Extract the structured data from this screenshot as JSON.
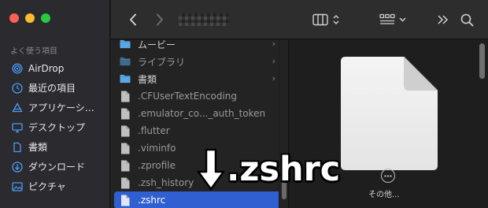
{
  "sidebar": {
    "section_title": "よく使う項目",
    "items": [
      {
        "label": "AirDrop",
        "icon": "airdrop-icon"
      },
      {
        "label": "最近の項目",
        "icon": "clock-icon"
      },
      {
        "label": "アプリケーシ…",
        "icon": "applications-icon"
      },
      {
        "label": "デスクトップ",
        "icon": "desktop-icon"
      },
      {
        "label": "書類",
        "icon": "document-icon"
      },
      {
        "label": "ダウンロード",
        "icon": "download-icon"
      },
      {
        "label": "ピクチャ",
        "icon": "pictures-icon"
      }
    ]
  },
  "files": [
    {
      "name": "ムービー",
      "type": "folder",
      "dim": false,
      "selected": false,
      "has_children": true
    },
    {
      "name": "ライブラリ",
      "type": "folder",
      "dim": true,
      "selected": false,
      "has_children": true
    },
    {
      "name": "書類",
      "type": "folder",
      "dim": false,
      "selected": false,
      "has_children": true
    },
    {
      "name": ".CFUserTextEncoding",
      "type": "file",
      "dim": true,
      "selected": false,
      "has_children": false
    },
    {
      "name": ".emulator_co..._auth_token",
      "type": "file",
      "dim": true,
      "selected": false,
      "has_children": false
    },
    {
      "name": ".flutter",
      "type": "file",
      "dim": true,
      "selected": false,
      "has_children": false
    },
    {
      "name": ".viminfo",
      "type": "file",
      "dim": true,
      "selected": false,
      "has_children": false
    },
    {
      "name": ".zprofile",
      "type": "file",
      "dim": true,
      "selected": false,
      "has_children": false
    },
    {
      "name": ".zsh_history",
      "type": "file",
      "dim": true,
      "selected": false,
      "has_children": false
    },
    {
      "name": ".zshrc",
      "type": "file",
      "dim": false,
      "selected": true,
      "has_children": false
    }
  ],
  "preview": {
    "more_label": "その他..."
  },
  "annotation": {
    "text": ".zshrc"
  },
  "colors": {
    "accent": "#2f5fd0",
    "folder": "#5aa8e6",
    "sidebar_icon": "#4a9bf5"
  }
}
